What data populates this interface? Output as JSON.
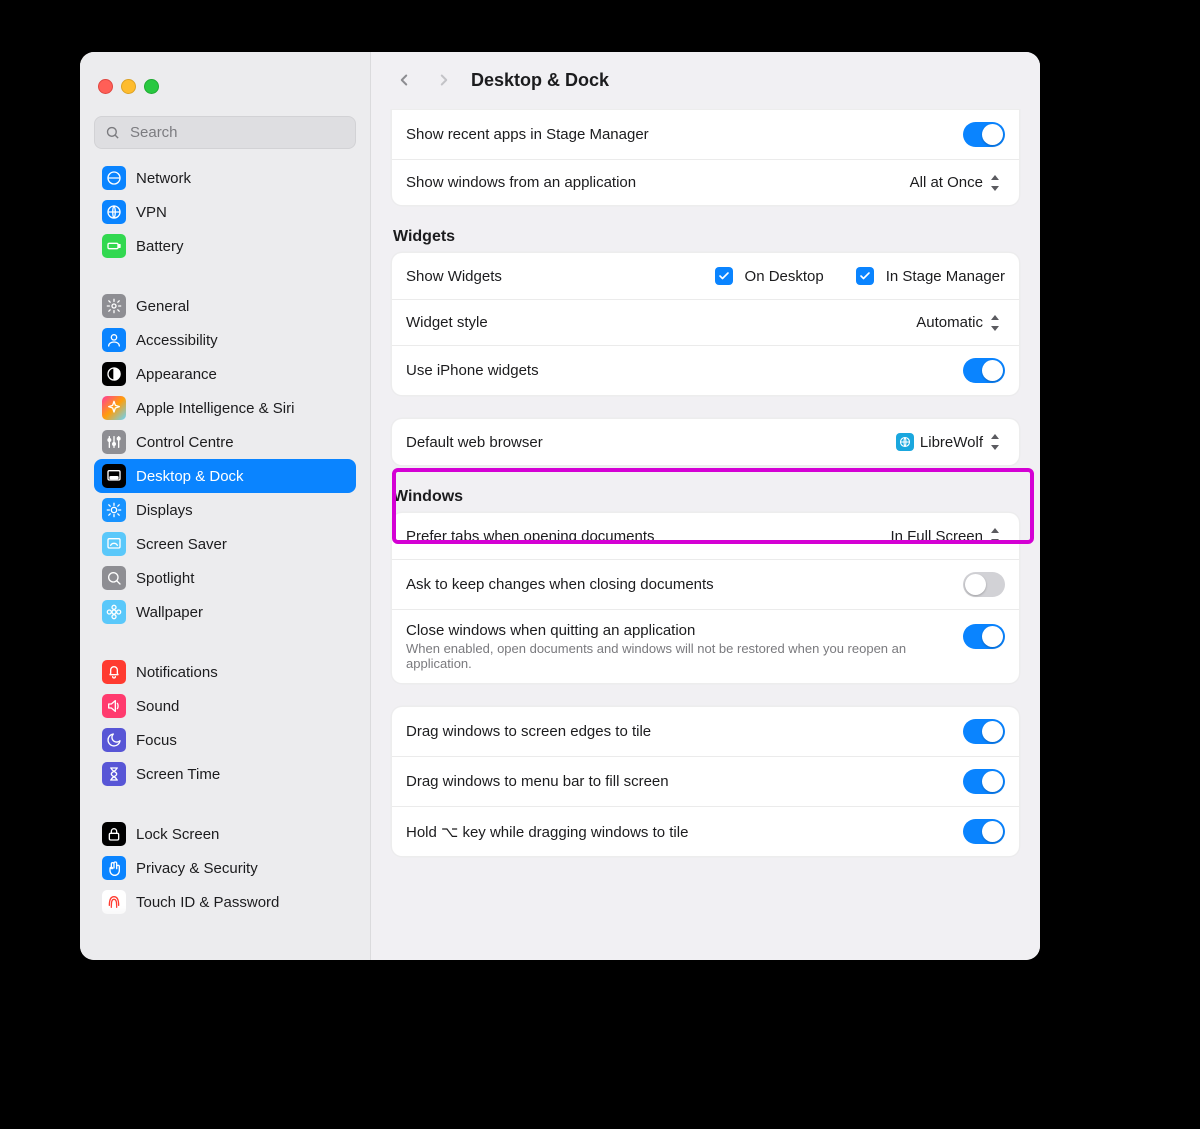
{
  "header": {
    "title": "Desktop & Dock"
  },
  "search": {
    "placeholder": "Search"
  },
  "sidebar": {
    "items": [
      {
        "label": "Network",
        "icon": "globe",
        "bg": "#0a84ff"
      },
      {
        "label": "VPN",
        "icon": "globe-grid",
        "bg": "#0a84ff"
      },
      {
        "label": "Battery",
        "icon": "battery",
        "bg": "#32d850"
      },
      {
        "label": "General",
        "icon": "gear",
        "bg": "#8e8e93"
      },
      {
        "label": "Accessibility",
        "icon": "person",
        "bg": "#0a84ff"
      },
      {
        "label": "Appearance",
        "icon": "appearance",
        "bg": "#000000"
      },
      {
        "label": "Apple Intelligence & Siri",
        "icon": "sparkle",
        "bg": "linear-gradient(135deg,#ff3b9d,#ff9f0a,#66d4ff)"
      },
      {
        "label": "Control Centre",
        "icon": "sliders",
        "bg": "#8e8e93"
      },
      {
        "label": "Desktop & Dock",
        "icon": "dock",
        "bg": "#000000",
        "active": true
      },
      {
        "label": "Displays",
        "icon": "sun",
        "bg": "#1893ff"
      },
      {
        "label": "Screen Saver",
        "icon": "screensaver",
        "bg": "#5ac8fa"
      },
      {
        "label": "Spotlight",
        "icon": "search",
        "bg": "#8e8e93"
      },
      {
        "label": "Wallpaper",
        "icon": "flower",
        "bg": "#5ac8fa"
      },
      {
        "label": "Notifications",
        "icon": "bell",
        "bg": "#ff3b30"
      },
      {
        "label": "Sound",
        "icon": "speaker",
        "bg": "#ff3b6e"
      },
      {
        "label": "Focus",
        "icon": "moon",
        "bg": "#5856d6"
      },
      {
        "label": "Screen Time",
        "icon": "hourglass",
        "bg": "#5856d6"
      },
      {
        "label": "Lock Screen",
        "icon": "lock",
        "bg": "#000000"
      },
      {
        "label": "Privacy & Security",
        "icon": "hand",
        "bg": "#0a84ff"
      },
      {
        "label": "Touch ID & Password",
        "icon": "touchid",
        "bg": "#ffffff"
      }
    ]
  },
  "stage_mgr": {
    "recent_label": "Show recent apps in Stage Manager",
    "recent_on": true,
    "show_from_label": "Show windows from an application",
    "show_from_value": "All at Once"
  },
  "widgets": {
    "heading": "Widgets",
    "show_label": "Show Widgets",
    "cb_desktop": "On Desktop",
    "cb_stage": "In Stage Manager",
    "style_label": "Widget style",
    "style_value": "Automatic",
    "iphone_label": "Use iPhone widgets",
    "iphone_on": true
  },
  "browser": {
    "label": "Default web browser",
    "value": "LibreWolf"
  },
  "windows": {
    "heading": "Windows",
    "tabs_label": "Prefer tabs when opening documents",
    "tabs_value": "In Full Screen",
    "ask_label": "Ask to keep changes when closing documents",
    "ask_on": false,
    "close_label": "Close windows when quitting an application",
    "close_sub": "When enabled, open documents and windows will not be restored when you reopen an application.",
    "close_on": true,
    "drag_edges_label": "Drag windows to screen edges to tile",
    "drag_edges_on": true,
    "drag_menubar_label": "Drag windows to menu bar to fill screen",
    "drag_menubar_on": true,
    "hold_opt_label": "Hold ⌥ key while dragging windows to tile",
    "hold_opt_on": true
  }
}
